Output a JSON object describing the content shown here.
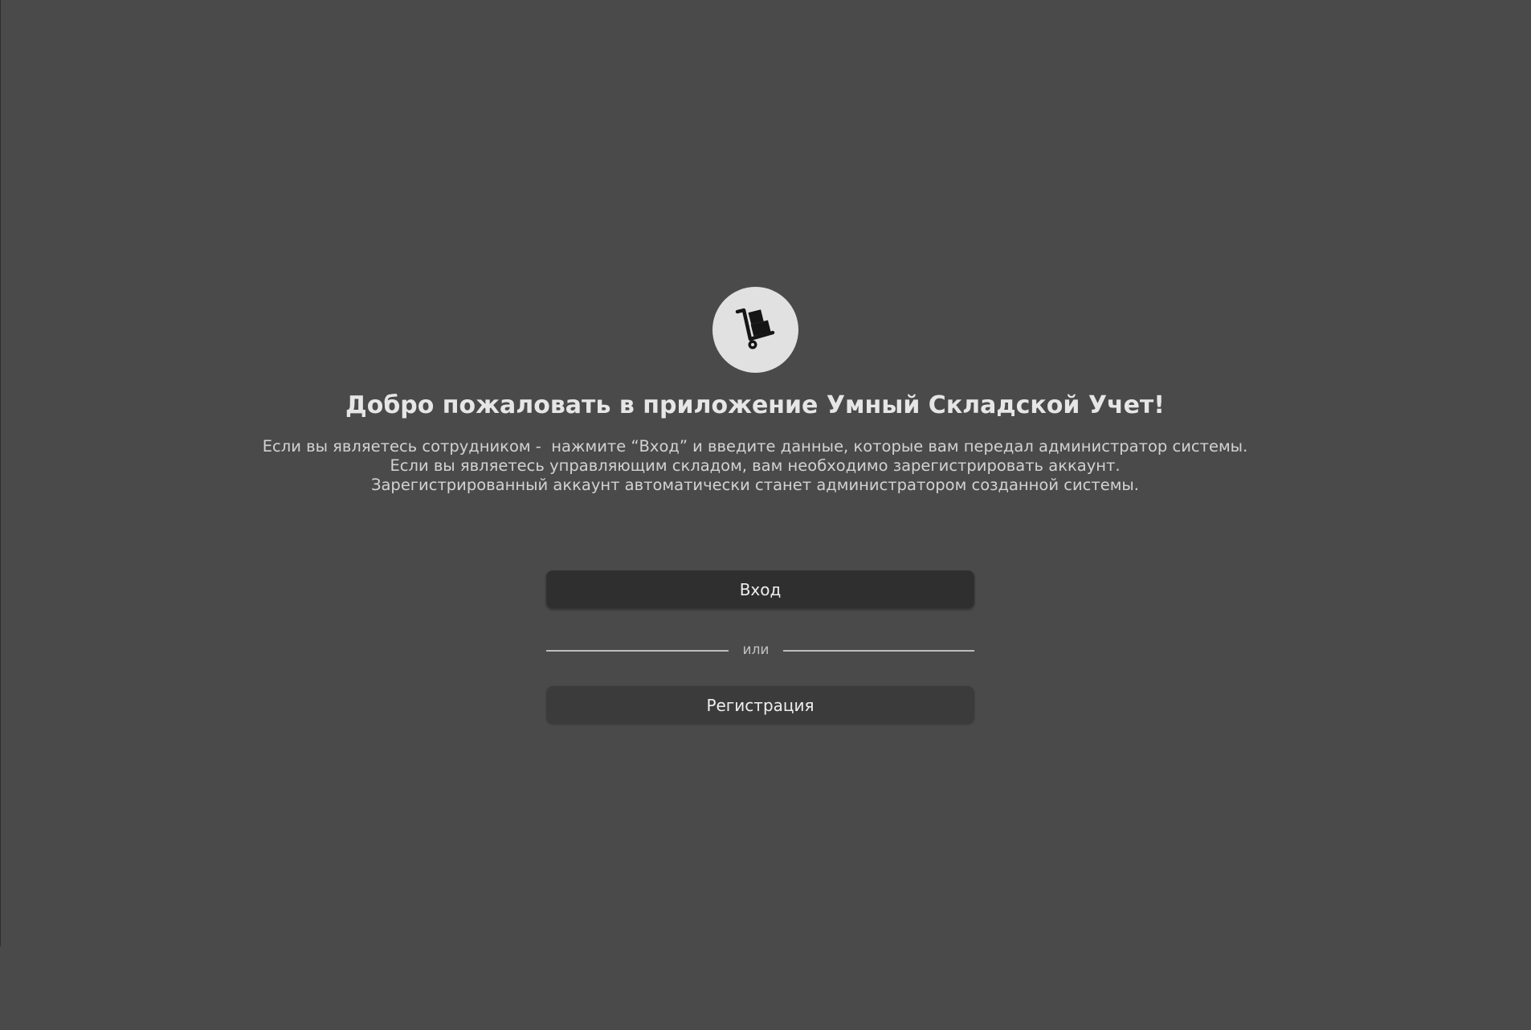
{
  "colors": {
    "background": "#4a4a4a",
    "logo_circle": "#e1e1e1",
    "primary_button": "#2f2f2f",
    "secondary_button": "#3b3b3b",
    "text": "#e6e6e6"
  },
  "logo": {
    "icon": "hand-truck-boxes-icon"
  },
  "welcome": {
    "title": "Добро пожаловать в приложение Умный Складской Учет!",
    "lines": [
      "Если вы являетесь сотрудником -  нажмите “Вход” и введите данные, которые вам передал администратор системы.",
      "Если вы являетесь управляющим складом, вам необходимо зарегистрировать аккаунт.",
      "Зарегистрированный аккаунт автоматически станет администратором созданной системы."
    ]
  },
  "actions": {
    "login_label": "Вход",
    "divider_label": "или",
    "register_label": "Регистрация"
  }
}
